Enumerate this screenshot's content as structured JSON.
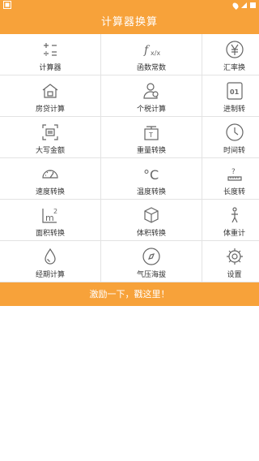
{
  "header": {
    "title": "计算器换算"
  },
  "items": [
    {
      "label": "计算器",
      "icon": "calculator-ops-icon"
    },
    {
      "label": "函数常数",
      "icon": "function-icon"
    },
    {
      "label": "汇率换",
      "icon": "currency-icon"
    },
    {
      "label": "房贷计算",
      "icon": "house-icon"
    },
    {
      "label": "个税计算",
      "icon": "person-icon"
    },
    {
      "label": "进制转",
      "icon": "binary-icon"
    },
    {
      "label": "大写金额",
      "icon": "cash-icon"
    },
    {
      "label": "重量转换",
      "icon": "weight-icon"
    },
    {
      "label": "时间转",
      "icon": "clock-icon"
    },
    {
      "label": "速度转换",
      "icon": "speedometer-icon"
    },
    {
      "label": "温度转换",
      "icon": "celsius-icon"
    },
    {
      "label": "长度转",
      "icon": "ruler-icon"
    },
    {
      "label": "面积转换",
      "icon": "area-m2-icon"
    },
    {
      "label": "体积转换",
      "icon": "cube-icon"
    },
    {
      "label": "体重计",
      "icon": "body-icon"
    },
    {
      "label": "经期计算",
      "icon": "drop-icon"
    },
    {
      "label": "气压海拔",
      "icon": "compass-icon"
    },
    {
      "label": "设置",
      "icon": "gear-icon"
    }
  ],
  "banner": {
    "text": "激励一下，戳这里！"
  },
  "colors": {
    "accent": "#f7a23a",
    "divider": "#e3e3e3"
  }
}
